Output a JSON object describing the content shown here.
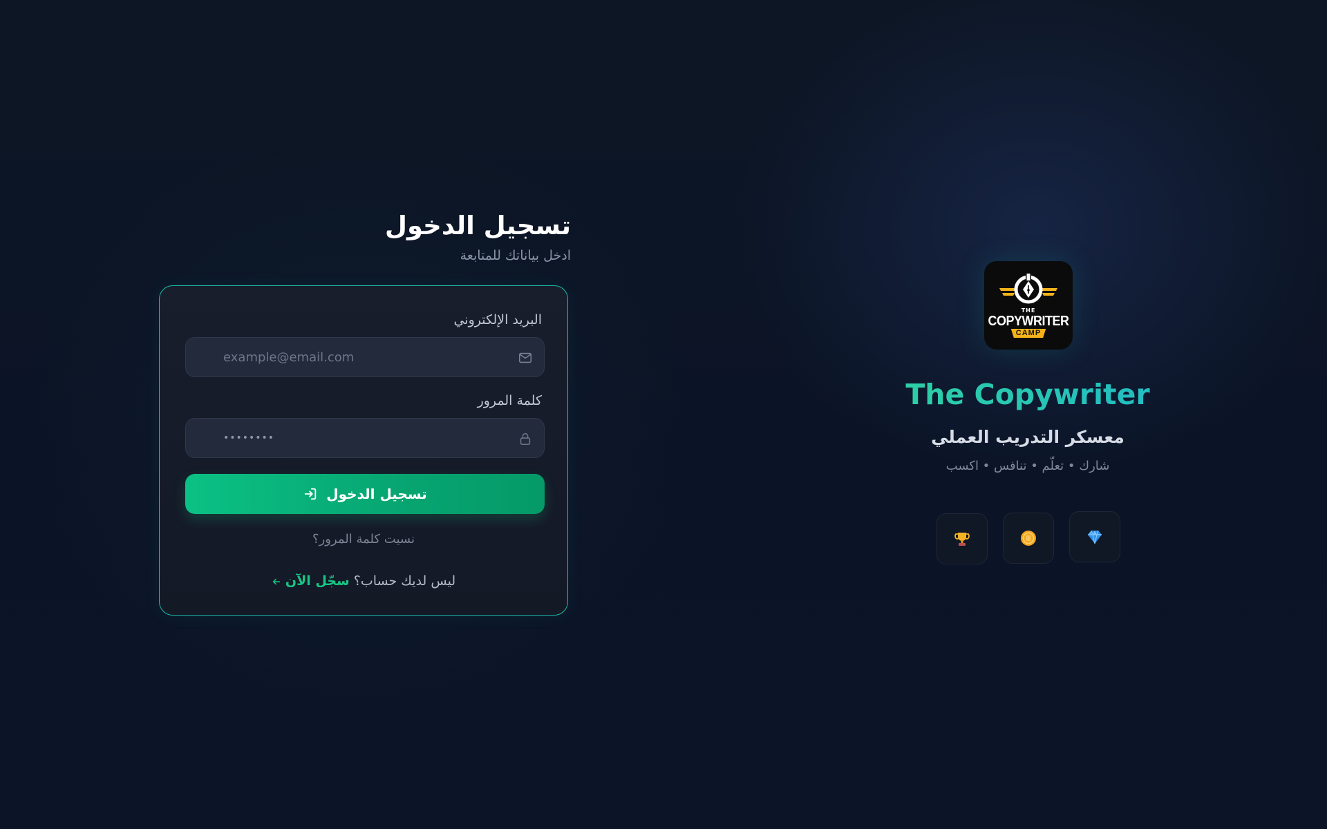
{
  "login": {
    "title": "تسجيل الدخول",
    "subtitle": "ادخل بياناتك للمتابعة",
    "email_label": "البريد الإلكتروني",
    "email_placeholder": "example@email.com",
    "email_icon": "mail-icon",
    "password_label": "كلمة المرور",
    "password_value": "••••••••",
    "password_icon": "lock-icon",
    "submit_label": "تسجيل الدخول",
    "submit_icon": "login-arrow-icon",
    "forgot_link": "نسيت كلمة المرور؟",
    "no_account_text": "ليس لديك حساب؟",
    "register_link": "سجّل الآن",
    "register_icon": "arrow-left-icon"
  },
  "brand": {
    "logo_text": {
      "top": "THE",
      "main": "COPYWRITER",
      "bottom": "CAMP"
    },
    "name": "The Copywriter",
    "tagline": "معسكر التدريب العملي",
    "motto": "شارك • تعلّم • تنافس • اكسب",
    "badges": [
      {
        "icon": "trophy-icon"
      },
      {
        "icon": "coin-icon"
      },
      {
        "icon": "diamond-icon"
      }
    ]
  },
  "colors": {
    "accent": "#10b981",
    "card_border": "#1fb8a6",
    "background": "#0c1528",
    "brand_gradient_start": "#2fd3a0",
    "brand_gradient_end": "#21b9c8"
  }
}
